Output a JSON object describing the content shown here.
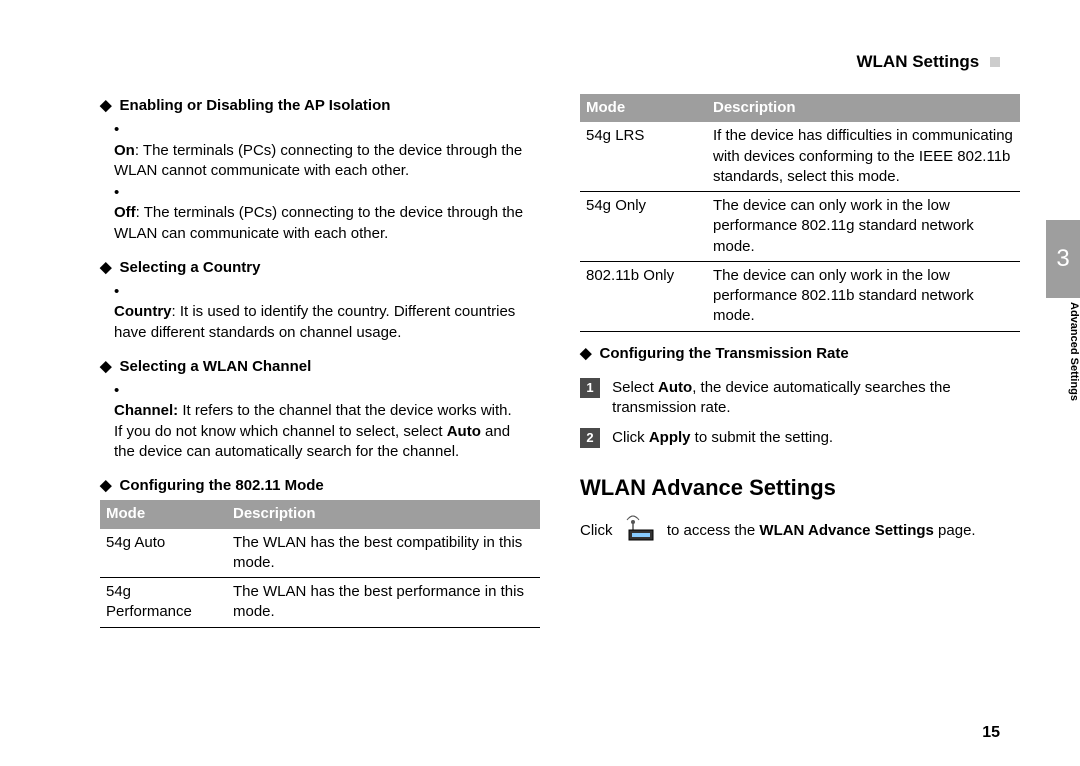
{
  "header": {
    "title": "WLAN Settings"
  },
  "tab": {
    "number": "3",
    "label": "Advanced Settings"
  },
  "pageNumber": "15",
  "left": {
    "s1": {
      "title": "Enabling or Disabling the AP Isolation",
      "b1_label": "On",
      "b1_text": ": The terminals (PCs) connecting to the device through the WLAN cannot communicate with each other.",
      "b2_label": "Off",
      "b2_text": ": The terminals (PCs) connecting to the device through the WLAN can communicate with each other."
    },
    "s2": {
      "title": "Selecting a Country",
      "b1_label": "Country",
      "b1_text": ": It is used to identify the country. Different countries have different standards on channel usage."
    },
    "s3": {
      "title": "Selecting a WLAN Channel",
      "b1_label": "Channel:",
      "b1_text_a": " It refers to the channel that the device works with. If you do not know which channel to select, select ",
      "b1_bold": "Auto",
      "b1_text_b": " and the device can automatically search for the channel."
    },
    "s4": {
      "title": "Configuring the 802.11 Mode"
    },
    "table1": {
      "h1": "Mode",
      "h2": "Description",
      "r1c1": "54g Auto",
      "r1c2": "The WLAN has the best compatibility in this mode.",
      "r2c1": "54g Performance",
      "r2c2": "The WLAN has the best performance in this mode."
    }
  },
  "right": {
    "table2": {
      "h1": "Mode",
      "h2": "Description",
      "r1c1": "54g LRS",
      "r1c2": "If the device has difficulties in communicating with devices conforming to the IEEE 802.11b standards, select this mode.",
      "r2c1": "54g Only",
      "r2c2": "The device can only work in the low performance 802.11g standard network mode.",
      "r3c1": "802.11b Only",
      "r3c2": "The device can only work in the low performance 802.11b standard network mode."
    },
    "s5": {
      "title": "Configuring the Transmission Rate"
    },
    "step1": {
      "num": "1",
      "a": "Select ",
      "bold": "Auto",
      "b": ", the device automatically searches the transmission rate."
    },
    "step2": {
      "num": "2",
      "a": "Click ",
      "bold": "Apply",
      "b": " to submit the setting."
    },
    "h2": "WLAN Advance Settings",
    "access": {
      "a": "Click ",
      "b": " to access the ",
      "bold": "WLAN Advance Settings",
      "c": " page."
    }
  }
}
